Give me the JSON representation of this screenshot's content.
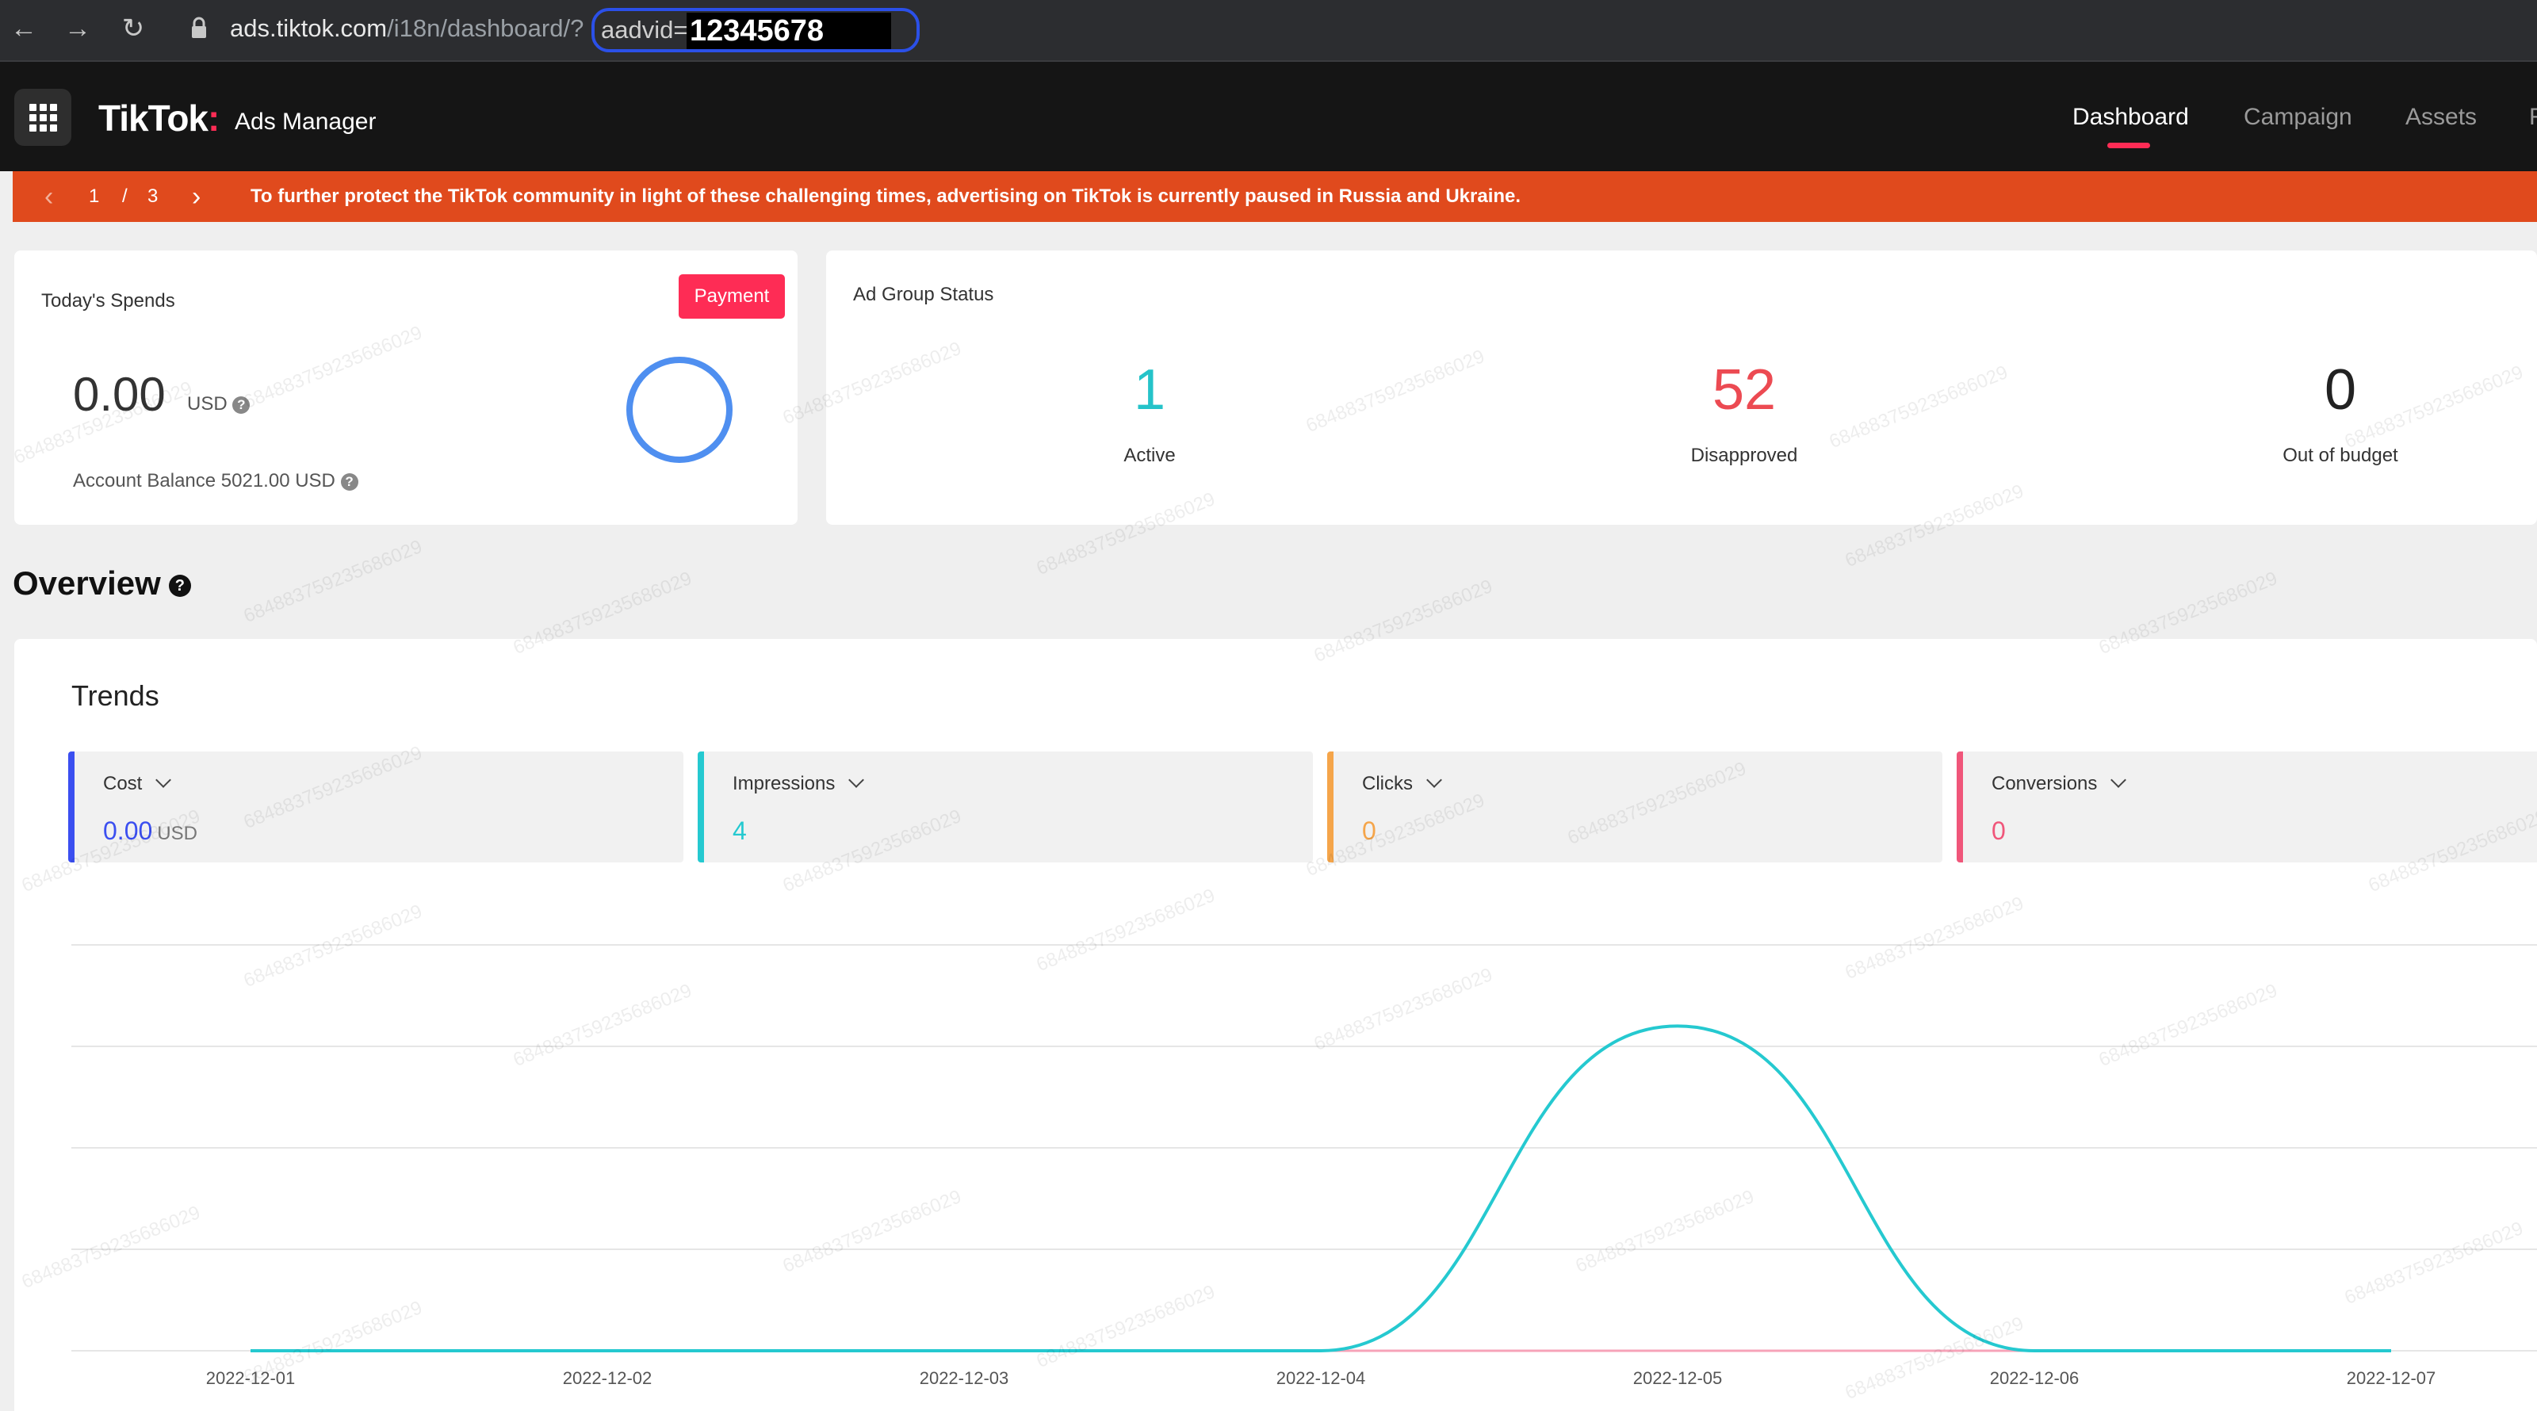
{
  "browser": {
    "back_icon": "←",
    "forward_icon": "→",
    "reload_icon": "↻",
    "url_base": "ads.tiktok.com",
    "url_path": "/i18n/dashboard/?",
    "url_param": "aadvid=",
    "url_id": "12345678"
  },
  "header": {
    "logo": "TikTok",
    "logo_dot": ":",
    "subtitle": "Ads Manager",
    "nav": [
      {
        "label": "Dashboard",
        "active": true
      },
      {
        "label": "Campaign",
        "active": false
      },
      {
        "label": "Assets",
        "active": false
      },
      {
        "label": "R",
        "active": false
      }
    ]
  },
  "notice": {
    "page_current": "1",
    "page_sep": "/",
    "page_total": "3",
    "prev_icon": "‹",
    "next_icon": "›",
    "message": "To further protect the TikTok community in light of these challenging times, advertising on TikTok is currently paused in Russia and Ukraine."
  },
  "spends": {
    "title": "Today's Spends",
    "payment_label": "Payment",
    "value": "0.00",
    "unit": "USD",
    "balance": "Account Balance 5021.00 USD"
  },
  "ad_group_status": {
    "title": "Ad Group Status",
    "items": [
      {
        "value": "1",
        "label": "Active",
        "color": "#25c3c9"
      },
      {
        "value": "52",
        "label": "Disapproved",
        "color": "#ec4a52"
      },
      {
        "value": "0",
        "label": "Out of budget",
        "color": "#222222"
      }
    ]
  },
  "overview": {
    "title": "Overview",
    "trends_title": "Trends",
    "metrics": [
      {
        "name": "Cost",
        "value": "0.00",
        "unit": "USD",
        "color": "#3b4ff0"
      },
      {
        "name": "Impressions",
        "value": "4",
        "unit": "",
        "color": "#25c9d0"
      },
      {
        "name": "Clicks",
        "value": "0",
        "unit": "",
        "color": "#f5a54a"
      },
      {
        "name": "Conversions",
        "value": "0",
        "unit": "",
        "color": "#f0567a"
      }
    ]
  },
  "watermark": "684883759235686029",
  "chart_data": {
    "type": "line",
    "categories": [
      "2022-12-01",
      "2022-12-02",
      "2022-12-03",
      "2022-12-04",
      "2022-12-05",
      "2022-12-06",
      "2022-12-07"
    ],
    "series": [
      {
        "name": "Impressions",
        "values": [
          0,
          0,
          0,
          0,
          4,
          0,
          0
        ],
        "color": "#25c9d0",
        "smooth": true
      },
      {
        "name": "Conversions",
        "values": [
          0,
          0,
          0,
          0,
          0,
          0,
          0
        ],
        "color": "#f6a3b8",
        "smooth": false
      }
    ],
    "ylim": [
      0,
      5
    ],
    "grid": true,
    "legend": "none"
  }
}
